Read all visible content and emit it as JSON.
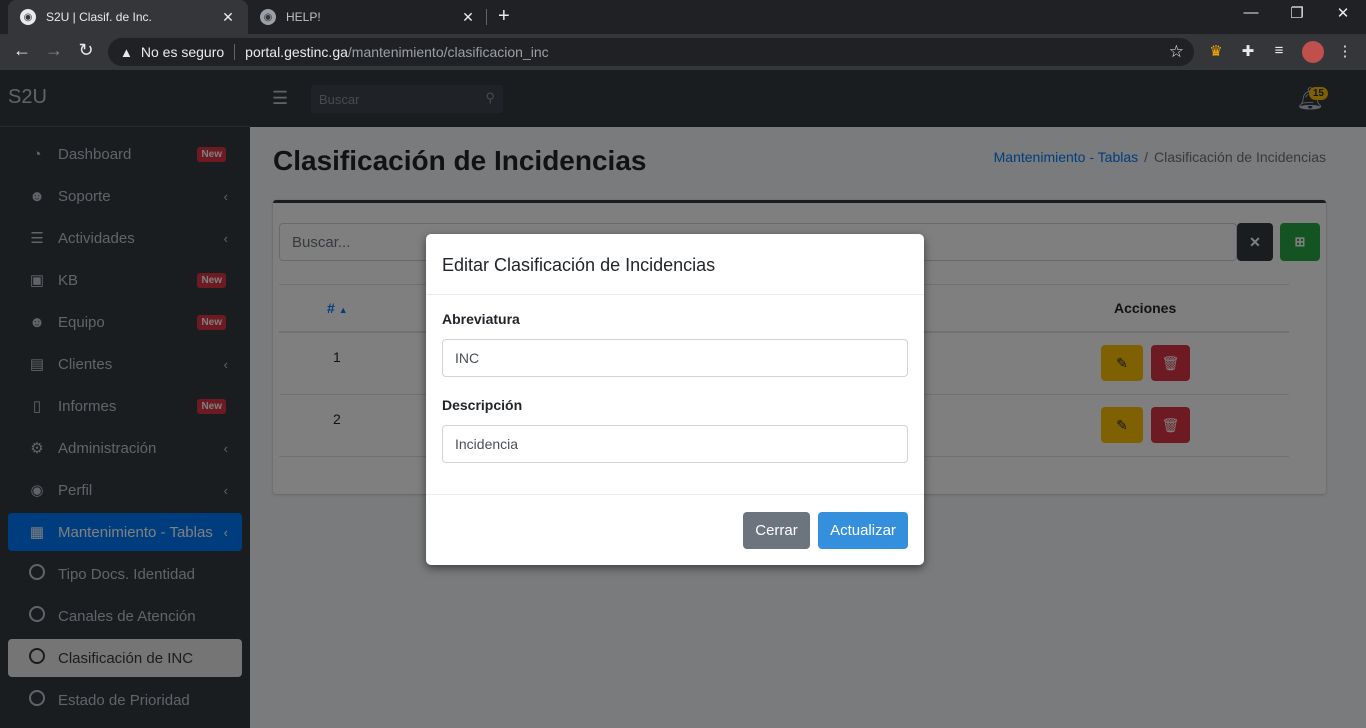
{
  "browser": {
    "tabs": [
      {
        "title": "S2U | Clasif. de Inc.",
        "active": true
      },
      {
        "title": "HELP!",
        "active": false
      }
    ],
    "security_label": "No es seguro",
    "url_domain": "portal.gestinc.ga",
    "url_path": "/mantenimiento/clasificacion_inc"
  },
  "sidebar": {
    "brand": "S2U",
    "items": [
      {
        "label": "Dashboard",
        "icon": "dashboard-icon",
        "badge": "New"
      },
      {
        "label": "Soporte",
        "icon": "users-icon"
      },
      {
        "label": "Actividades",
        "icon": "tasks-icon"
      },
      {
        "label": "KB",
        "icon": "kb-icon",
        "badge": "New"
      },
      {
        "label": "Equipo",
        "icon": "team-icon",
        "badge": "New"
      },
      {
        "label": "Clientes",
        "icon": "address-book-icon"
      },
      {
        "label": "Informes",
        "icon": "file-icon",
        "badge": "New"
      },
      {
        "label": "Administración",
        "icon": "gear-icon"
      },
      {
        "label": "Perfil",
        "icon": "user-circle-icon"
      },
      {
        "label": "Mantenimiento - Tablas",
        "icon": "table-icon",
        "active": true
      },
      {
        "label": "Tipo Docs. Identidad",
        "icon": "circle-icon"
      },
      {
        "label": "Canales de Atención",
        "icon": "circle-icon"
      },
      {
        "label": "Clasificación de INC",
        "icon": "circle-icon",
        "selected": true
      },
      {
        "label": "Estado de Prioridad",
        "icon": "circle-icon"
      }
    ]
  },
  "topnav": {
    "search_placeholder": "Buscar",
    "notifications_count": "15"
  },
  "page": {
    "title": "Clasificación de Incidencias",
    "breadcrumb_link": "Mantenimiento - Tablas",
    "breadcrumb_sep": "/",
    "breadcrumb_current": "Clasificación de Incidencias"
  },
  "card": {
    "search_placeholder": "Buscar...",
    "columns": {
      "number": "#",
      "actions": "Acciones"
    },
    "rows": [
      {
        "number": "1"
      },
      {
        "number": "2"
      }
    ]
  },
  "modal": {
    "title": "Editar Clasificación de Incidencias",
    "abbr_label": "Abreviatura",
    "abbr_value": "INC",
    "desc_label": "Descripción",
    "desc_value": "Incidencia",
    "close_label": "Cerrar",
    "update_label": "Actualizar"
  },
  "colors": {
    "primary": "#007bff",
    "sidebar_bg": "#343a40",
    "success": "#28a745",
    "warning": "#ffc107",
    "danger": "#dc3545",
    "secondary": "#6c757d",
    "update_button": "#3490dc"
  }
}
